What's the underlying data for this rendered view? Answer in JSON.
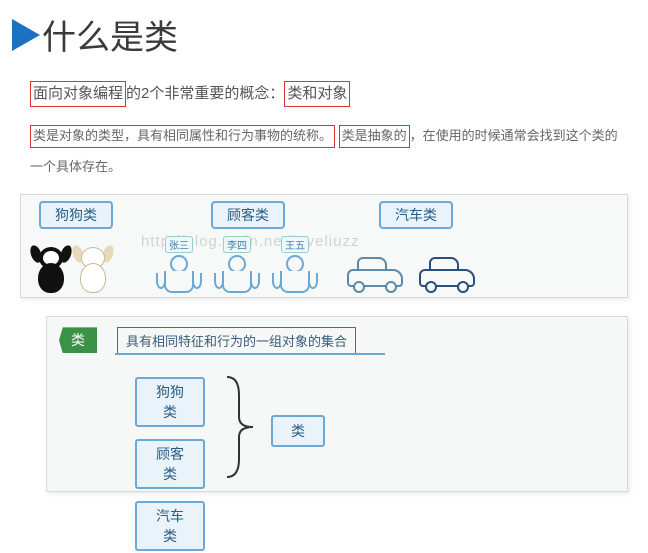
{
  "header": {
    "title": "什么是类"
  },
  "intro": {
    "part1_hl": "面向对象编程",
    "part2": "的2个非常重要的概念：",
    "part3_hl": "类和对象"
  },
  "desc": {
    "hl1": "类是对象的类型，具有相同属性和行为事物的统称。",
    "hl2": "类是抽象的",
    "rest": "，在使用的时候通常会找到这个类的一个具体存在。"
  },
  "illus1": {
    "labels": {
      "dog": "狗狗类",
      "customer": "顾客类",
      "car": "汽车类"
    },
    "persons": [
      "张三",
      "李四",
      "王五"
    ],
    "watermark": "http://plog.csdn.net/loveliuzz"
  },
  "illus2": {
    "tag": "类",
    "definition": "具有相同特征和行为的一组对象的集合",
    "list": [
      "狗狗类",
      "顾客类",
      "汽车类"
    ],
    "group_label": "类"
  }
}
